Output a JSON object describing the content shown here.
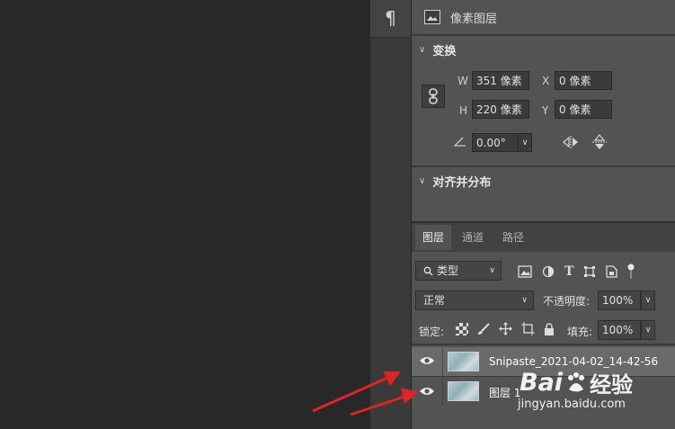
{
  "paragraph_icon": "paragraph-icon",
  "properties": {
    "header_label": "像素图层",
    "transform_title": "变换",
    "w_label": "W",
    "w_value": "351 像素",
    "x_label": "X",
    "x_value": "0 像素",
    "h_label": "H",
    "h_value": "220 像素",
    "y_label": "Y",
    "y_value": "0 像素",
    "angle_value": "0.00°",
    "align_title": "对齐并分布"
  },
  "layers_panel": {
    "tabs": [
      "图层",
      "通道",
      "路径"
    ],
    "filter_kind": "类型",
    "blend_mode": "正常",
    "opacity_label": "不透明度:",
    "opacity_value": "100%",
    "lock_label": "锁定:",
    "fill_label": "填充:",
    "fill_value": "100%",
    "layers": [
      {
        "name": "Snipaste_2021-04-02_14-42-56"
      },
      {
        "name": "图层 1"
      }
    ]
  },
  "watermark": {
    "brand": "Bai",
    "brand2": "经验",
    "url": "jingyan.baidu.com"
  },
  "colors": {
    "arrow": "#e02424",
    "panel_bg": "#535353",
    "canvas_bg": "#282828"
  }
}
